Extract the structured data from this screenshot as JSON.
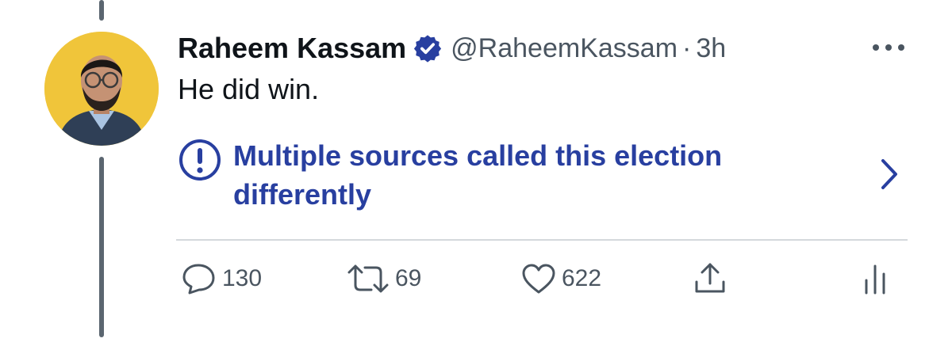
{
  "tweet": {
    "author_name": "Raheem Kassam",
    "handle": "@RaheemKassam",
    "separator": "·",
    "time": "3h",
    "text": "He did win.",
    "verified": true
  },
  "notice": {
    "line1": "Multiple sources called this election",
    "line2": "differently",
    "icon": "exclamation-circle-icon",
    "color": "#283fa0"
  },
  "actions": {
    "reply_count": "130",
    "retweet_count": "69",
    "like_count": "622"
  },
  "colors": {
    "accent": "#283fa0",
    "verified_badge": "#283fa0",
    "text": "#0f1419",
    "secondary_text": "#4a5560",
    "thread_line": "#5b6670",
    "avatar_background": "#f0c53a"
  }
}
